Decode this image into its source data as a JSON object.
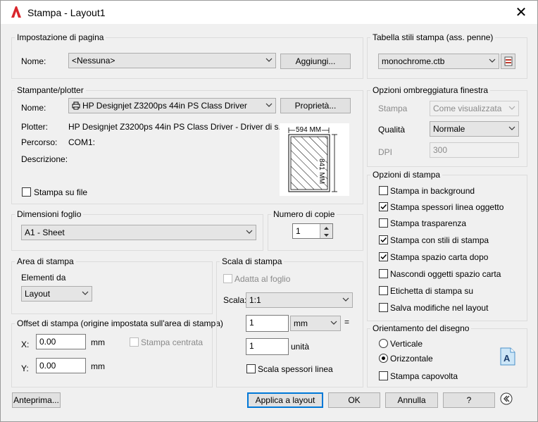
{
  "window": {
    "title": "Stampa - Layout1",
    "close_glyph": "✕"
  },
  "page_setup": {
    "legend": "Impostazione di pagina",
    "name_label": "Nome:",
    "name_value": "<Nessuna>",
    "add_button": "Aggiungi..."
  },
  "plotter": {
    "legend": "Stampante/plotter",
    "name_label": "Nome:",
    "name_value": "HP Designjet Z3200ps 44in PS Class Driver",
    "properties_button": "Proprietà...",
    "plotter_label": "Plotter:",
    "plotter_value": "HP Designjet Z3200ps 44in PS Class Driver - Driver di s...",
    "path_label": "Percorso:",
    "path_value": "COM1:",
    "description_label": "Descrizione:",
    "print_to_file": "Stampa su file",
    "preview_width": "594 MM",
    "preview_height": "841 MM"
  },
  "paper_size": {
    "legend": "Dimensioni foglio",
    "value": "A1 - Sheet"
  },
  "copies": {
    "legend": "Numero di copie",
    "value": "1"
  },
  "plot_area": {
    "legend": "Area di stampa",
    "what_label": "Elementi da",
    "what_value": "Layout"
  },
  "plot_offset": {
    "legend": "Offset di stampa (origine impostata sull'area di stampa)",
    "x_label": "X:",
    "x_value": "0.00",
    "x_unit": "mm",
    "y_label": "Y:",
    "y_value": "0.00",
    "y_unit": "mm",
    "center": "Stampa centrata"
  },
  "plot_scale": {
    "legend": "Scala di stampa",
    "fit": "Adatta al foglio",
    "scale_label": "Scala:",
    "scale_value": "1:1",
    "value1": "1",
    "unit1": "mm",
    "equals": "=",
    "value2": "1",
    "unit2": "unità",
    "lineweights": "Scala spessori linea"
  },
  "style_table": {
    "legend": "Tabella stili stampa (ass. penne)",
    "value": "monochrome.ctb"
  },
  "shaded": {
    "legend": "Opzioni ombreggiatura finestra",
    "shade_label": "Stampa",
    "shade_value": "Come visualizzata",
    "quality_label": "Qualità",
    "quality_value": "Normale",
    "dpi_label": "DPI",
    "dpi_value": "300"
  },
  "plot_options": {
    "legend": "Opzioni di stampa",
    "items": [
      {
        "label": "Stampa in background",
        "checked": false
      },
      {
        "label": "Stampa spessori linea oggetto",
        "checked": true
      },
      {
        "label": "Stampa trasparenza",
        "checked": false
      },
      {
        "label": "Stampa con stili di stampa",
        "checked": true
      },
      {
        "label": "Stampa spazio carta dopo",
        "checked": true
      },
      {
        "label": "Nascondi oggetti spazio carta",
        "checked": false
      },
      {
        "label": "Etichetta di stampa su",
        "checked": false
      },
      {
        "label": "Salva modifiche nel layout",
        "checked": false
      }
    ]
  },
  "orientation": {
    "legend": "Orientamento del disegno",
    "portrait": "Verticale",
    "landscape": "Orizzontale",
    "upside_down": "Stampa capovolta",
    "selected": "Orizzontale"
  },
  "footer": {
    "preview": "Anteprima...",
    "apply": "Applica a layout",
    "ok": "OK",
    "cancel": "Annulla",
    "help": "?"
  }
}
